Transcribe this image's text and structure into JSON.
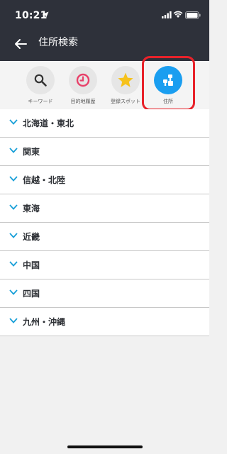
{
  "status_bar": {
    "time": "10:21"
  },
  "header": {
    "title": "住所検索"
  },
  "tabs": [
    {
      "label": "キーワード",
      "icon": "search-icon"
    },
    {
      "label": "目的地履歴",
      "icon": "clock-icon"
    },
    {
      "label": "登録スポット",
      "icon": "star-icon"
    },
    {
      "label": "住所",
      "icon": "address-icon",
      "active": true
    }
  ],
  "regions": [
    "北海道・東北",
    "関東",
    "信越・北陸",
    "東海",
    "近畿",
    "中国",
    "四国",
    "九州・沖縄"
  ],
  "colors": {
    "header_bg": "#2e313a",
    "accent": "#1a9ef0",
    "highlight": "#e8222a",
    "chevron": "#1aa0d8"
  }
}
